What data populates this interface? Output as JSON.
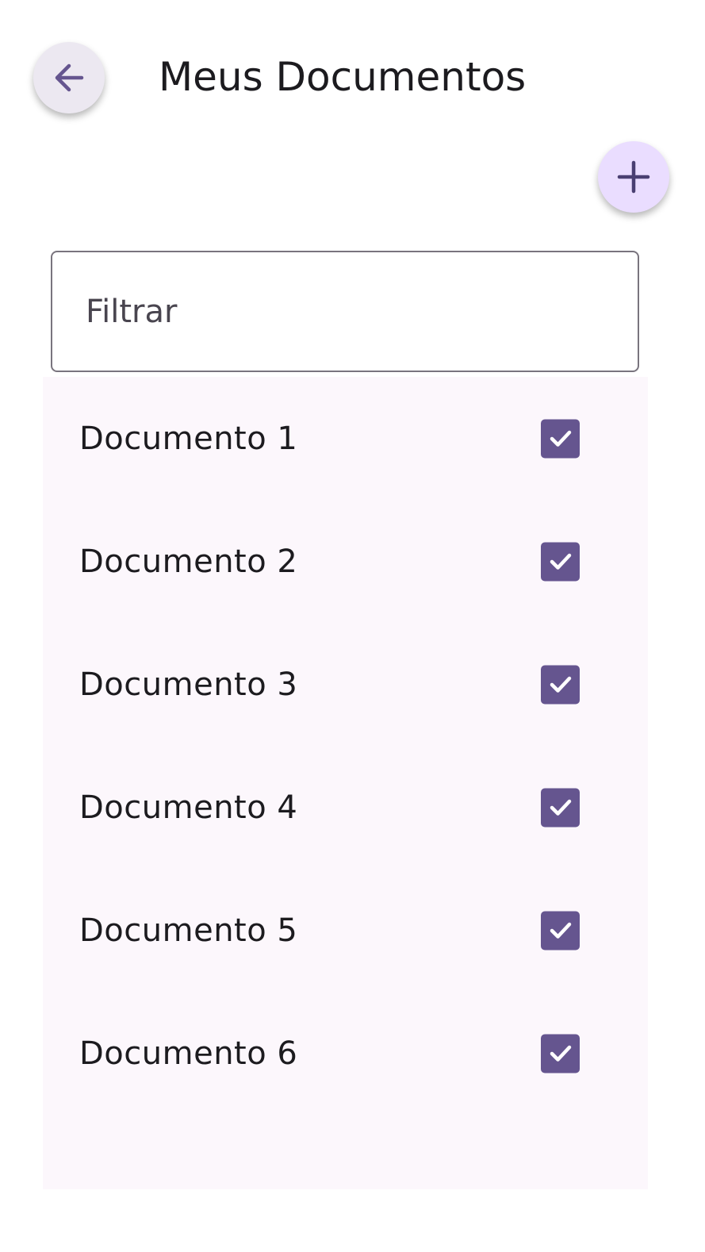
{
  "header": {
    "title": "Meus Documentos",
    "back_icon": "arrow-left-icon"
  },
  "fab": {
    "add_icon": "plus-icon"
  },
  "filter": {
    "placeholder": "Filtrar",
    "value": ""
  },
  "documents": [
    {
      "label": "Documento 1",
      "checked": true
    },
    {
      "label": "Documento 2",
      "checked": true
    },
    {
      "label": "Documento 3",
      "checked": true
    },
    {
      "label": "Documento 4",
      "checked": true
    },
    {
      "label": "Documento 5",
      "checked": true
    },
    {
      "label": "Documento 6",
      "checked": true
    }
  ],
  "colors": {
    "primary": "#65558F",
    "back_button_bg": "#ECE8F1",
    "fab_bg": "#EADDFF",
    "list_bg": "#FCF7FC",
    "outline": "#79747E",
    "on_surface": "#1C1B1F"
  }
}
